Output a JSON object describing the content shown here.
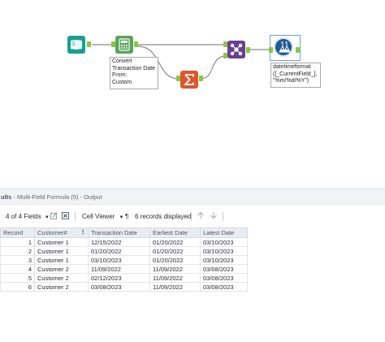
{
  "workflow": {
    "formula_annotation": "Convert\nTransaction Date\nFrom:\nCustom",
    "mff_annotation": "datetimeformat\n([_CurrentField_],\n\"%m/%d/%Y\")",
    "colors": {
      "input": "#19a08f",
      "formula": "#5ba35b",
      "summarize": "#e0552b",
      "join": "#6a3f8f",
      "multifield": "#1f5a96",
      "connector": "#86c93f",
      "wire": "#8a8a8a"
    }
  },
  "results": {
    "title_prefix": "ults",
    "title_rest": " - Multi-Field Formula (5) - Output",
    "fields_label": "4 of 4 Fields",
    "cell_viewer_label": "Cell Viewer",
    "records_label": "6 records displayed",
    "columns": [
      "Record",
      "Customer#",
      "Transaction Date",
      "Earliest Date",
      "Latest Date"
    ],
    "rows": [
      [
        "1",
        "Customer 1",
        "12/15/2022",
        "01/20/2022",
        "03/10/2023"
      ],
      [
        "2",
        "Customer 1",
        "01/20/2022",
        "01/20/2022",
        "03/10/2023"
      ],
      [
        "3",
        "Customer 1",
        "03/10/2023",
        "01/20/2022",
        "03/10/2023"
      ],
      [
        "4",
        "Customer 2",
        "11/09/2022",
        "11/09/2022",
        "03/08/2023"
      ],
      [
        "5",
        "Customer 2",
        "02/12/2023",
        "11/09/2022",
        "03/08/2023"
      ],
      [
        "6",
        "Customer 2",
        "03/08/2023",
        "11/09/2022",
        "03/08/2023"
      ]
    ]
  }
}
